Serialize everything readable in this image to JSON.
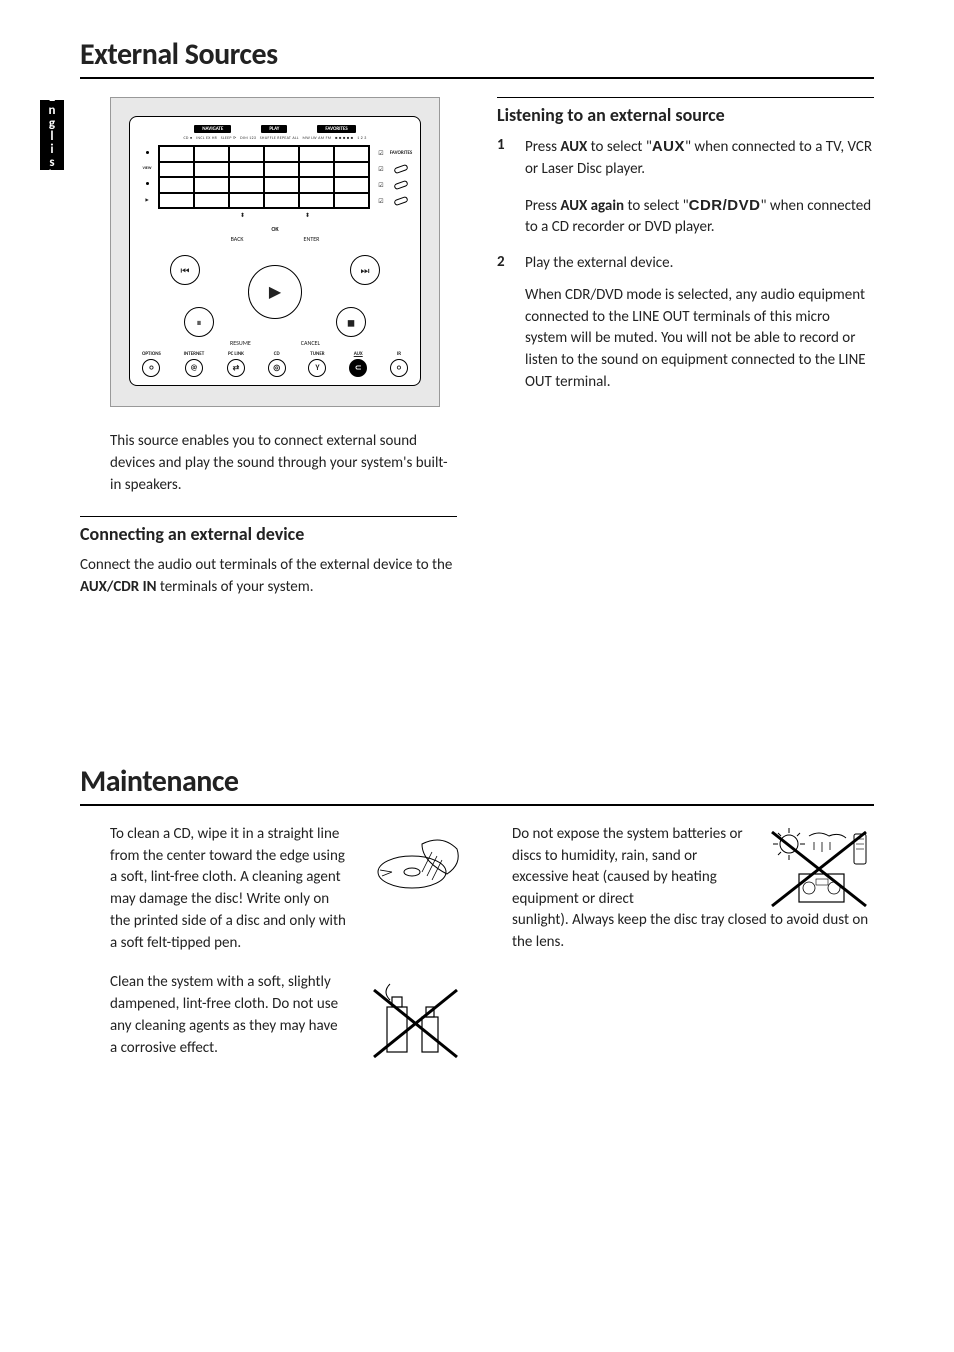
{
  "language_tab": "English",
  "section1": {
    "title": "External Sources",
    "intro": "This source enables you to connect external sound devices and play the sound through your system's built-in speakers.",
    "subheading_connect": "Connecting an external device",
    "connect_body_1": "Connect the audio out terminals of the external device to the ",
    "connect_bold": "AUX/CDR IN",
    "connect_body_2": " terminals of your system.",
    "subheading_listen": "Listening to an external source",
    "step1_num": "1",
    "step1_a": "Press ",
    "step1_b": "AUX",
    "step1_c": " to select \"",
    "step1_d": "AUX",
    "step1_e": "\" when connected to a TV,  VCR or Laser Disc player.",
    "step1_p2a": "Press ",
    "step1_p2b": "AUX again",
    "step1_p2c": " to select \"",
    "step1_p2d": "CDR/DVD",
    "step1_p2e": "\" when connected to a CD recorder or DVD player.",
    "step2_num": "2",
    "step2_a": "Play the external device.",
    "step2_note": "When CDR/DVD mode is selected, any audio equipment connected to the LINE OUT terminals of this micro system will be muted. You will not be able to record or listen to the sound on equipment connected to the LINE OUT terminal."
  },
  "device_panel": {
    "head1": "NAVIGATE",
    "head2": "PLAY",
    "head3": "FAVORITES",
    "fav_side": "FAVORITES",
    "ok": "OK",
    "back": "BACK",
    "enter": "ENTER",
    "resume": "RESUME",
    "cancel": "CANCEL",
    "view": "VIEW",
    "sources": [
      {
        "label": "OPTIONS",
        "icon": "○"
      },
      {
        "label": "INTERNET",
        "icon": "@"
      },
      {
        "label": "PC LINK",
        "icon": "⇄"
      },
      {
        "label": "CD",
        "icon": "◎"
      },
      {
        "label": "TUNER",
        "icon": "Y"
      },
      {
        "label": "AUX",
        "icon": "⊂",
        "active": true
      },
      {
        "label": "IR",
        "icon": "○"
      }
    ]
  },
  "section2": {
    "title": "Maintenance",
    "p1": "To clean a CD, wipe it in a straight line from the center toward the edge using a soft, lint-free cloth.  A cleaning agent may damage the disc!  Write only on the printed side of a disc and only with a soft felt-tipped pen.",
    "p2": "Clean the system with a soft, slightly dampened, lint-free cloth.  Do not use any cleaning agents as they may have a corrosive effect.",
    "p3": "Do not expose the system batteries or discs to humidity, rain, sand or excessive heat (caused by heating equipment or direct sunlight).  Always keep the disc tray closed to avoid dust on the lens."
  }
}
